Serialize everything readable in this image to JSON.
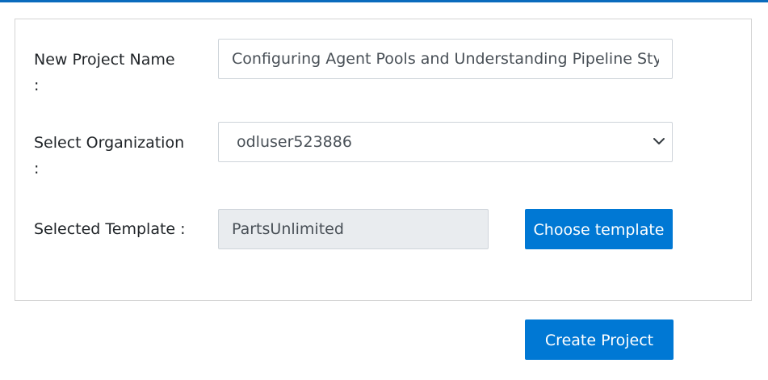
{
  "form": {
    "project_name": {
      "label": "New Project Name",
      "colon": ":",
      "value": "Configuring Agent Pools and Understanding Pipeline Styl"
    },
    "organization": {
      "label": "Select Organization",
      "colon": ":",
      "value": "odluser523886"
    },
    "template": {
      "label": "Selected Template :",
      "value": "PartsUnlimited"
    },
    "choose_template_label": "Choose template"
  },
  "actions": {
    "create_project_label": "Create Project"
  },
  "colors": {
    "accent": "#0078d4",
    "top_bar": "#0a6bbd",
    "readonly_bg": "#e9ecef"
  },
  "icons": {
    "select_arrow": "chevron-down-icon"
  }
}
